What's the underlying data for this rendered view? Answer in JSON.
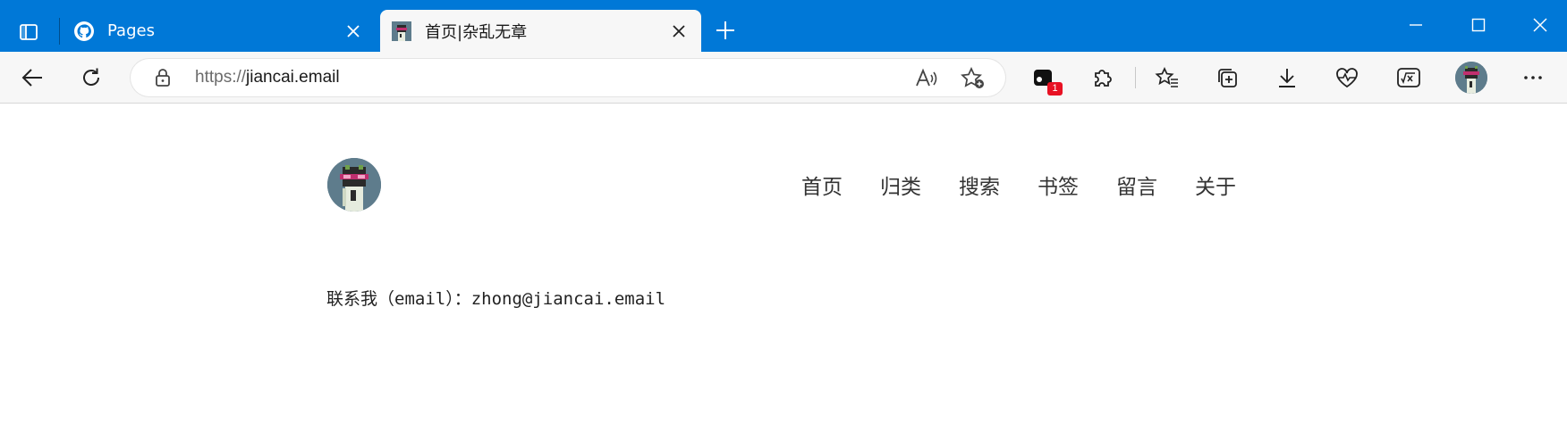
{
  "browser": {
    "tabs": [
      {
        "title": "Pages",
        "favicon": "github-icon",
        "active": false
      },
      {
        "title": "首页|杂乱无章",
        "favicon": "pixel-avatar-icon",
        "active": true
      }
    ],
    "address": {
      "scheme": "https://",
      "host": "jiancai.email"
    },
    "extension_badge": "1",
    "colors": {
      "titlebar": "#0078d7",
      "toolbar": "#f7f7f7",
      "badge": "#e81123"
    },
    "icons": [
      "tab-actions-icon",
      "close-icon",
      "new-tab-icon",
      "minimize-icon",
      "maximize-icon",
      "window-close-icon",
      "back-icon",
      "refresh-icon",
      "lock-icon",
      "read-aloud-icon",
      "add-favorite-icon",
      "extension-app-icon",
      "extensions-puzzle-icon",
      "favorites-icon",
      "collections-icon",
      "download-icon",
      "browser-essentials-icon",
      "math-solver-icon",
      "profile-avatar",
      "more-icon"
    ]
  },
  "site": {
    "nav": [
      "首页",
      "归类",
      "搜索",
      "书签",
      "留言",
      "关于"
    ],
    "contact_text": "联系我（email）：zhong@jiancai.email"
  }
}
